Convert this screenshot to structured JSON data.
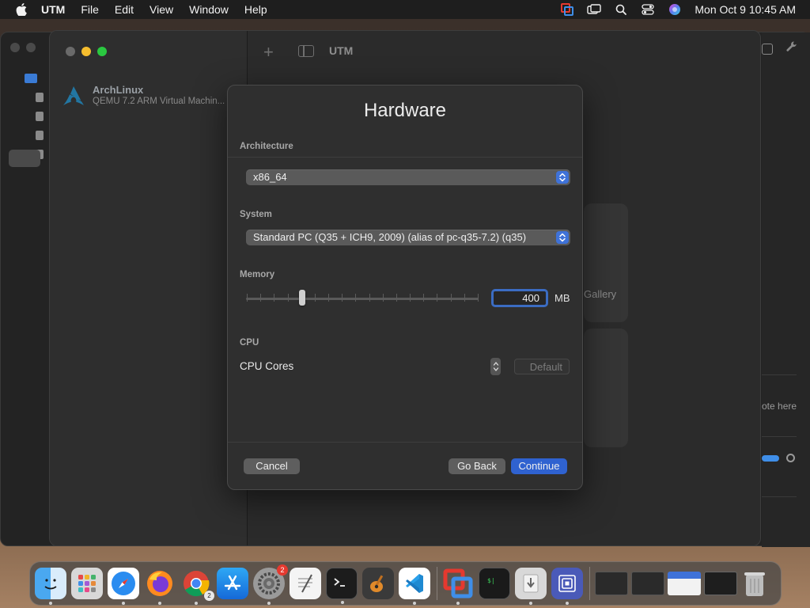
{
  "menubar": {
    "app_name": "UTM",
    "items": [
      "File",
      "Edit",
      "View",
      "Window",
      "Help"
    ],
    "clock": "Mon Oct 9  10:45 AM"
  },
  "window": {
    "toolbar_title": "UTM",
    "vm": {
      "name": "ArchLinux",
      "description": "QEMU 7.2 ARM Virtual Machin..."
    },
    "card_text": "Gallery",
    "side_text": "ote here"
  },
  "sheet": {
    "title": "Hardware",
    "architecture": {
      "label": "Architecture",
      "value": "x86_64"
    },
    "system": {
      "label": "System",
      "value": "Standard PC (Q35 + ICH9, 2009) (alias of pc-q35-7.2) (q35)"
    },
    "memory": {
      "label": "Memory",
      "value": "400",
      "unit": "MB"
    },
    "cpu": {
      "label": "CPU",
      "cores_label": "CPU Cores",
      "cores_placeholder": "Default"
    },
    "buttons": {
      "cancel": "Cancel",
      "go_back": "Go Back",
      "continue": "Continue"
    }
  },
  "dock": {
    "badges": {
      "system_settings": "2",
      "chrome": "2"
    },
    "apps": [
      "finder-icon",
      "launchpad-icon",
      "safari-icon",
      "firefox-icon",
      "chrome-icon",
      "app-store-icon",
      "system-settings-icon",
      "textedit-icon",
      "terminal-icon",
      "garageband-icon",
      "vscode-icon",
      "parallels-icon",
      "terminal-icon",
      "preview-icon",
      "utm-icon",
      "trash-icon"
    ]
  },
  "colors": {
    "accent": "#2f62d0",
    "focus_ring": "#3b6cc2"
  }
}
